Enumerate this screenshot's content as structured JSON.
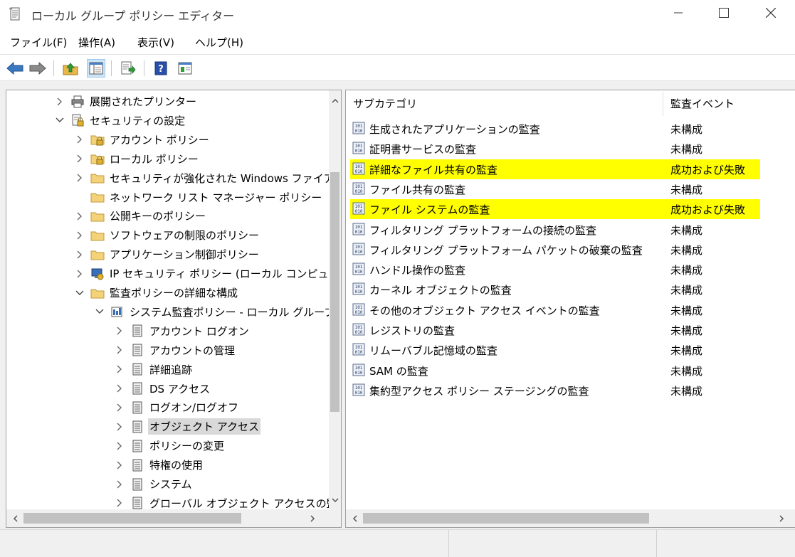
{
  "window": {
    "title": "ローカル グループ ポリシー エディター",
    "icons": [
      "gpedit-app-icon",
      "minimize-icon",
      "maximize-icon",
      "close-icon"
    ]
  },
  "menu": [
    {
      "label": "ファイル(F)"
    },
    {
      "label": "操作(A)"
    },
    {
      "label": "表示(V)"
    },
    {
      "label": "ヘルプ(H)"
    }
  ],
  "toolbar": {
    "icons": [
      "back-arrow-icon",
      "forward-arrow-icon",
      "up-folder-icon",
      "show-hide-tree-icon",
      "export-list-icon",
      "help-icon",
      "properties-icon"
    ]
  },
  "tree": {
    "items": [
      {
        "label": "展開されたプリンター",
        "icon": "printer-icon",
        "expander": "collapsed"
      },
      {
        "label": "セキュリティの設定",
        "icon": "security-settings-icon",
        "expander": "expanded"
      },
      {
        "label": "アカウント ポリシー",
        "icon": "locked-folder-icon",
        "expander": "collapsed"
      },
      {
        "label": "ローカル ポリシー",
        "icon": "locked-folder-icon",
        "expander": "collapsed"
      },
      {
        "label": "セキュリティが強化された Windows ファイア",
        "icon": "folder-icon",
        "expander": "collapsed"
      },
      {
        "label": "ネットワーク リスト マネージャー ポリシー",
        "icon": "folder-icon",
        "expander": "none"
      },
      {
        "label": "公開キーのポリシー",
        "icon": "folder-icon",
        "expander": "collapsed"
      },
      {
        "label": "ソフトウェアの制限のポリシー",
        "icon": "folder-icon",
        "expander": "collapsed"
      },
      {
        "label": "アプリケーション制御ポリシー",
        "icon": "folder-icon",
        "expander": "collapsed"
      },
      {
        "label": "IP セキュリティ ポリシー (ローカル コンピュータ",
        "icon": "ip-security-icon",
        "expander": "collapsed"
      },
      {
        "label": "監査ポリシーの詳細な構成",
        "icon": "folder-icon",
        "expander": "expanded"
      },
      {
        "label": "システム監査ポリシー - ローカル グループ",
        "icon": "audit-policy-icon",
        "expander": "expanded"
      },
      {
        "label": "アカウント ログオン",
        "icon": "audit-category-icon",
        "expander": "collapsed"
      },
      {
        "label": "アカウントの管理",
        "icon": "audit-category-icon",
        "expander": "collapsed"
      },
      {
        "label": "詳細追跡",
        "icon": "audit-category-icon",
        "expander": "collapsed"
      },
      {
        "label": "DS アクセス",
        "icon": "audit-category-icon",
        "expander": "collapsed"
      },
      {
        "label": "ログオン/ログオフ",
        "icon": "audit-category-icon",
        "expander": "collapsed"
      },
      {
        "label": "オブジェクト アクセス",
        "icon": "audit-category-icon",
        "expander": "collapsed",
        "selected": true
      },
      {
        "label": "ポリシーの変更",
        "icon": "audit-category-icon",
        "expander": "collapsed"
      },
      {
        "label": "特権の使用",
        "icon": "audit-category-icon",
        "expander": "collapsed"
      },
      {
        "label": "システム",
        "icon": "audit-category-icon",
        "expander": "collapsed"
      },
      {
        "label": "グローバル オブジェクト アクセスの監",
        "icon": "audit-category-icon",
        "expander": "collapsed"
      }
    ]
  },
  "list": {
    "columns": [
      {
        "label": "サブカテゴリ"
      },
      {
        "label": "監査イベント"
      }
    ],
    "rows": [
      {
        "name": "生成されたアプリケーションの監査",
        "value": "未構成",
        "highlighted": false
      },
      {
        "name": "証明書サービスの監査",
        "value": "未構成",
        "highlighted": false
      },
      {
        "name": "詳細なファイル共有の監査",
        "value": "成功および失敗",
        "highlighted": true
      },
      {
        "name": "ファイル共有の監査",
        "value": "未構成",
        "highlighted": false
      },
      {
        "name": "ファイル システムの監査",
        "value": "成功および失敗",
        "highlighted": true
      },
      {
        "name": "フィルタリング プラットフォームの接続の監査",
        "value": "未構成",
        "highlighted": false
      },
      {
        "name": "フィルタリング プラットフォーム パケットの破棄の監査",
        "value": "未構成",
        "highlighted": false
      },
      {
        "name": "ハンドル操作の監査",
        "value": "未構成",
        "highlighted": false
      },
      {
        "name": "カーネル オブジェクトの監査",
        "value": "未構成",
        "highlighted": false
      },
      {
        "name": "その他のオブジェクト アクセス イベントの監査",
        "value": "未構成",
        "highlighted": false
      },
      {
        "name": "レジストリの監査",
        "value": "未構成",
        "highlighted": false
      },
      {
        "name": "リムーバブル記憶域の監査",
        "value": "未構成",
        "highlighted": false
      },
      {
        "name": "SAM の監査",
        "value": "未構成",
        "highlighted": false
      },
      {
        "name": "集約型アクセス ポリシー ステージングの監査",
        "value": "未構成",
        "highlighted": false
      }
    ],
    "row_icon": "audit-subcategory-icon",
    "highlight_color": "#ffff00"
  }
}
